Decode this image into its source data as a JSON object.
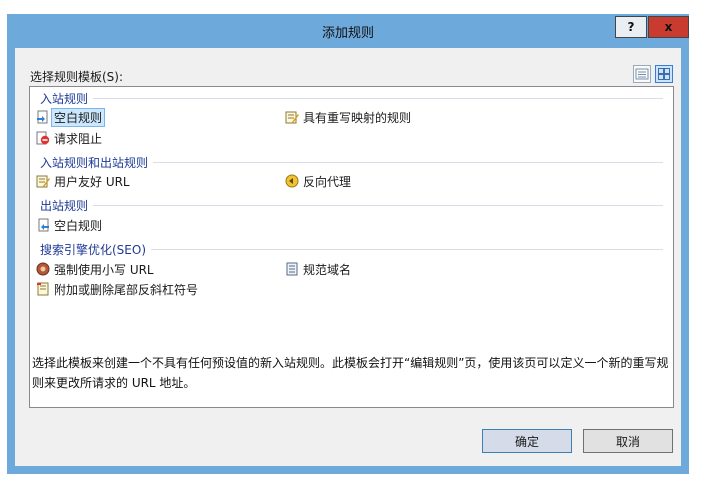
{
  "window": {
    "title": "添加规则",
    "help_label": "?",
    "close_label": "x"
  },
  "selector_label": "选择规则模板(S):",
  "groups": [
    {
      "header": "入站规则",
      "items": [
        "空白规则",
        "具有重写映射的规则",
        "请求阻止"
      ]
    },
    {
      "header": "入站规则和出站规则",
      "items": [
        "用户友好 URL",
        "反向代理"
      ]
    },
    {
      "header": "出站规则",
      "items": [
        "空白规则"
      ]
    },
    {
      "header": "搜索引擎优化(SEO)",
      "items": [
        "强制使用小写 URL",
        "规范域名",
        "附加或删除尾部反斜杠符号"
      ]
    }
  ],
  "description": "选择此模板来创建一个不具有任何预设值的新入站规则。此模板会打开“编辑规则”页，使用该页可以定义一个新的重写规则来更改所请求的 URL 地址。",
  "buttons": {
    "ok": "确定",
    "cancel": "取消"
  },
  "colors": {
    "title_bar": "#6ea9dc",
    "group_header": "#1e3a96",
    "selection": "#cce8ff",
    "close_button": "#c83b2e"
  }
}
